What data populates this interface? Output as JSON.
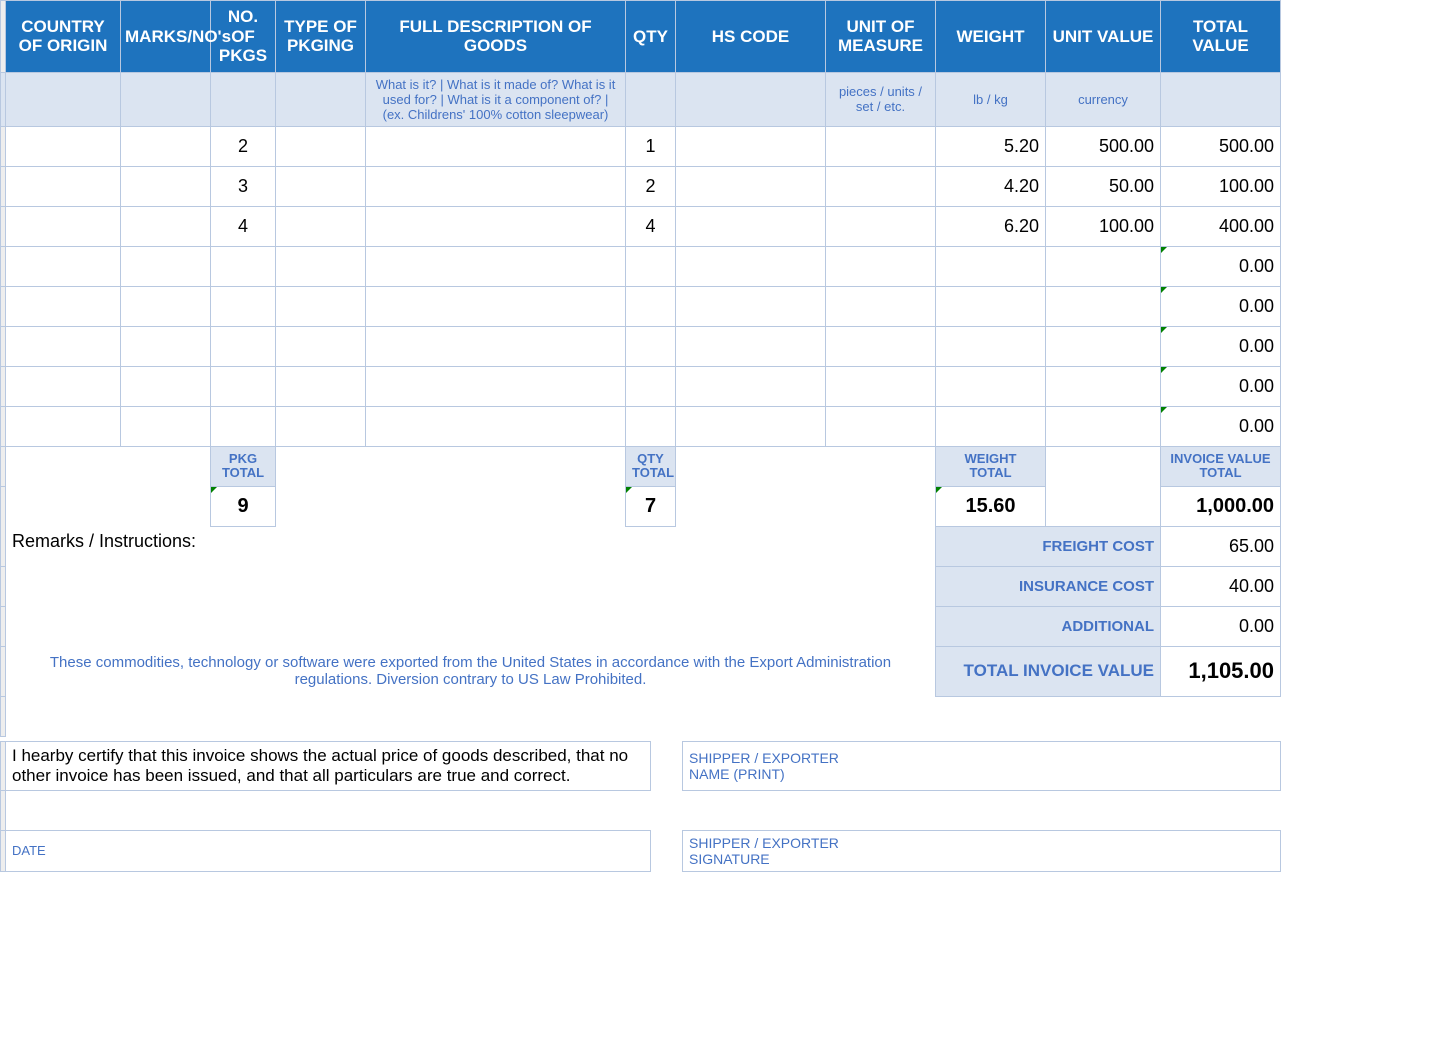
{
  "headers": {
    "country": "COUNTRY OF ORIGIN",
    "marks": "MARKS/NO's",
    "pkgs": "NO. OF PKGS",
    "pkging": "TYPE OF PKGING",
    "desc": "FULL DESCRIPTION OF GOODS",
    "qty": "QTY",
    "hs": "HS CODE",
    "uom": "UNIT OF MEASURE",
    "weight": "WEIGHT",
    "unitval": "UNIT VALUE",
    "totalval": "TOTAL VALUE"
  },
  "hints": {
    "desc": "What is it? | What is it made of? What is it used for? | What is it a component of? | (ex. Childrens' 100% cotton sleepwear)",
    "uom": "pieces / units / set / etc.",
    "weight": "lb / kg",
    "unitval": "currency"
  },
  "rows": [
    {
      "pkgs": "2",
      "qty": "1",
      "weight": "5.20",
      "unitval": "500.00",
      "totalval": "500.00"
    },
    {
      "pkgs": "3",
      "qty": "2",
      "weight": "4.20",
      "unitval": "50.00",
      "totalval": "100.00"
    },
    {
      "pkgs": "4",
      "qty": "4",
      "weight": "6.20",
      "unitval": "100.00",
      "totalval": "400.00"
    },
    {
      "pkgs": "",
      "qty": "",
      "weight": "",
      "unitval": "",
      "totalval": "0.00",
      "mark": true
    },
    {
      "pkgs": "",
      "qty": "",
      "weight": "",
      "unitval": "",
      "totalval": "0.00",
      "mark": true
    },
    {
      "pkgs": "",
      "qty": "",
      "weight": "",
      "unitval": "",
      "totalval": "0.00",
      "mark": true
    },
    {
      "pkgs": "",
      "qty": "",
      "weight": "",
      "unitval": "",
      "totalval": "0.00",
      "mark": true
    },
    {
      "pkgs": "",
      "qty": "",
      "weight": "",
      "unitval": "",
      "totalval": "0.00",
      "mark": true
    }
  ],
  "totals_labels": {
    "pkg": "PKG TOTAL",
    "qty": "QTY TOTAL",
    "weight": "WEIGHT TOTAL",
    "invoice": "INVOICE VALUE TOTAL"
  },
  "totals": {
    "pkg": "9",
    "qty": "7",
    "weight": "15.60",
    "invoice": "1,000.00"
  },
  "remarks_label": "Remarks / Instructions:",
  "costs": {
    "freight_label": "FREIGHT COST",
    "freight": "65.00",
    "insurance_label": "INSURANCE COST",
    "insurance": "40.00",
    "additional_label": "ADDITIONAL",
    "additional": "0.00",
    "total_label": "TOTAL INVOICE VALUE",
    "total": "1,105.00"
  },
  "export_note": "These commodities, technology or software were exported from the United States in accordance with the Export Administration regulations.  Diversion contrary to US Law Prohibited.",
  "certify": "I hearby certify that this invoice shows the actual price of goods described, that no other invoice has been issued, and that all particulars are true and correct.",
  "sig": {
    "name_l1": "SHIPPER / EXPORTER",
    "name_l2": "NAME (PRINT)",
    "sig_l1": "SHIPPER / EXPORTER",
    "sig_l2": "SIGNATURE"
  },
  "date_label": "DATE"
}
